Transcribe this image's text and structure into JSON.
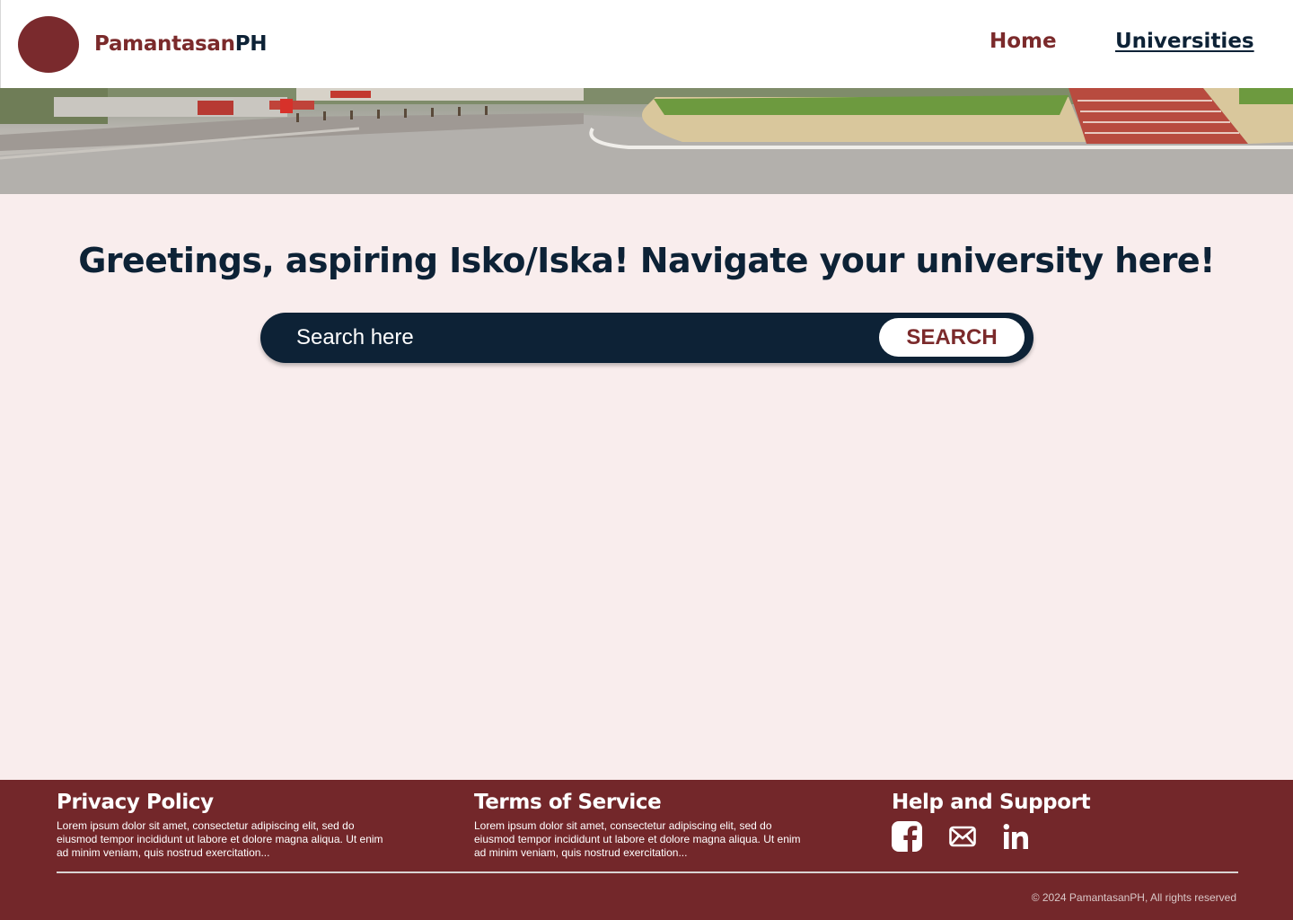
{
  "header": {
    "brand_part1": "Pamantasan",
    "brand_part2": "PH",
    "nav": {
      "home": "Home",
      "universities": "Universities"
    }
  },
  "colors": {
    "primary": "#7b2a2b",
    "navy": "#0d2236",
    "background": "#f9eded",
    "footer": "#73272a"
  },
  "main": {
    "greeting": "Greetings, aspiring Isko/Iska! Navigate your university here!",
    "search": {
      "placeholder": "Search here",
      "button_label": "SEARCH"
    }
  },
  "footer": {
    "privacy": {
      "title": "Privacy Policy",
      "text": "Lorem ipsum dolor sit amet, consectetur adipiscing elit, sed do eiusmod tempor incididunt ut labore et dolore magna aliqua. Ut enim ad minim veniam, quis nostrud exercitation..."
    },
    "terms": {
      "title": "Terms of Service",
      "text": "Lorem ipsum dolor sit amet, consectetur adipiscing elit, sed do eiusmod tempor incididunt ut labore et dolore magna aliqua. Ut enim ad minim veniam, quis nostrud exercitation..."
    },
    "help": {
      "title": "Help and Support",
      "icons": [
        "facebook-icon",
        "mail-icon",
        "linkedin-icon"
      ]
    },
    "copyright": "© 2024 PamantasanPH, All rights reserved"
  }
}
